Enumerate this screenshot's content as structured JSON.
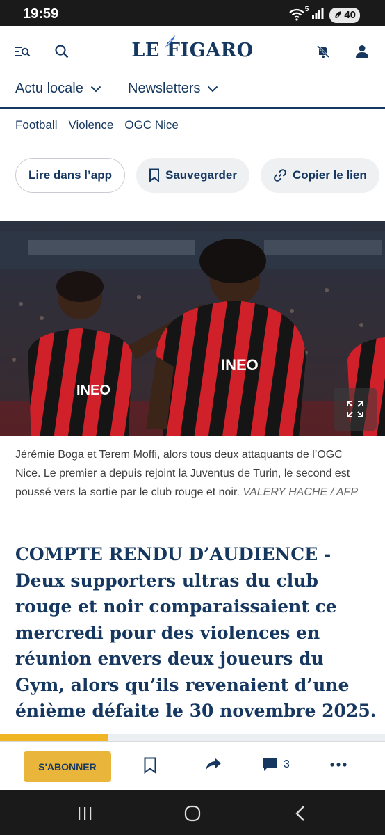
{
  "status_bar": {
    "time": "19:59",
    "wifi_badge": "5",
    "battery": "40",
    "icons": [
      "wifi-icon",
      "signal-icon",
      "battery-icon"
    ]
  },
  "header": {
    "logo": "LE FIGARO",
    "icons": [
      "menu-search-icon",
      "search-icon",
      "bell-off-icon",
      "user-icon"
    ]
  },
  "nav": {
    "items": [
      {
        "label": "Actu locale"
      },
      {
        "label": "Newsletters"
      }
    ]
  },
  "tags": [
    "Football",
    "Violence",
    "OGC Nice"
  ],
  "actions": {
    "read_in_app": "Lire dans l’app",
    "save": "Sauvegarder",
    "copy_link": "Copier le lien"
  },
  "photo": {
    "caption": "Jérémie Boga et Terem Moffi, alors tous deux attaquants de l’OGC Nice. Le premier a depuis rejoint la Juventus de Turin, le second est poussé vers la sortie par le club rouge et noir.",
    "credit": "VALERY HACHE / AFP"
  },
  "headline": "COMPTE RENDU D’AUDIENCE - Deux supporters ultras du club rouge et noir comparaissaient ce mercredi pour des violences en réunion envers deux joueurs du Gym, alors qu’ils revenaient d’une énième défaite le 30 novembre 2025.",
  "reading_progress": 0.28,
  "bottom_bar": {
    "subscribe": "S'ABONNER",
    "comment_count": "3",
    "icons": [
      "bookmark-icon",
      "share-icon",
      "comment-icon",
      "more-icon"
    ]
  },
  "colors": {
    "brand_navy": "#163860",
    "accent_gold": "#e9b53a",
    "progress": "#f0b525",
    "nice_red": "#d0202a"
  }
}
